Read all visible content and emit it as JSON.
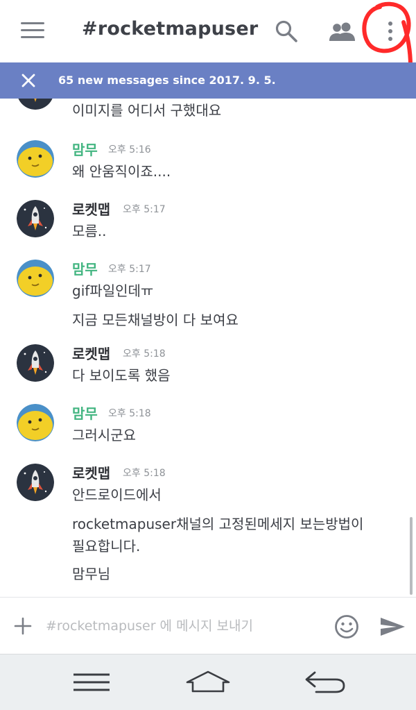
{
  "header": {
    "channel_title": "#rocketmapuser"
  },
  "banner": {
    "text": "65 new messages since 2017. 9. 5."
  },
  "messages": {
    "partial_first": "이미지를 어디서 구했대요",
    "groups": [
      {
        "author": "맘무",
        "time": "오후 5:16",
        "lines": [
          "왜 안움직이죠...."
        ]
      },
      {
        "author": "로켓맵",
        "time": "오후 5:17",
        "lines": [
          "모름.."
        ]
      },
      {
        "author": "맘무",
        "time": "오후 5:17",
        "lines": [
          "gif파일인데ㅠ",
          "지금 모든채널방이 다 보여요"
        ]
      },
      {
        "author": "로켓맵",
        "time": "오후 5:18",
        "lines": [
          "다 보이도록 했음"
        ]
      },
      {
        "author": "맘무",
        "time": "오후 5:18",
        "lines": [
          "그러시군요"
        ]
      },
      {
        "author": "로켓맵",
        "time": "오후 5:18",
        "lines": [
          "안드로이드에서",
          "rocketmapuser채널의 고정된메세지 보는방법이",
          "필요합니다.",
          "맘무님"
        ]
      }
    ]
  },
  "composer": {
    "placeholder": "#rocketmapuser 에 메시지 보내기"
  },
  "colors": {
    "banner": "#6a80c4",
    "author_mammu": "#43b581",
    "annotation": "#ff2a2a"
  },
  "icons": {
    "menu": "hamburger-icon",
    "search": "search-icon",
    "members": "members-icon",
    "more": "kebab-icon",
    "close": "close-icon",
    "add": "plus-icon",
    "emoji": "emoji-icon",
    "send": "send-icon"
  }
}
